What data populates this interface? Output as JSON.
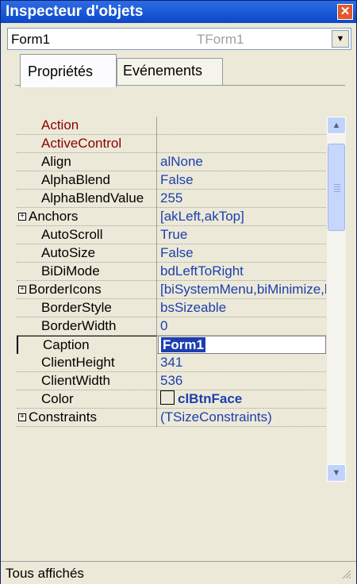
{
  "window": {
    "title": "Inspecteur d'objets"
  },
  "object_combo": {
    "name": "Form1",
    "class": "TForm1"
  },
  "tabs": [
    {
      "label": "Propriétés"
    },
    {
      "label": "Evénements"
    }
  ],
  "properties": [
    {
      "name": "Action",
      "value": ""
    },
    {
      "name": "ActiveControl",
      "value": ""
    },
    {
      "name": "Align",
      "value": "alNone"
    },
    {
      "name": "AlphaBlend",
      "value": "False"
    },
    {
      "name": "AlphaBlendValue",
      "value": "255"
    },
    {
      "name": "Anchors",
      "value": "[akLeft,akTop]"
    },
    {
      "name": "AutoScroll",
      "value": "True"
    },
    {
      "name": "AutoSize",
      "value": "False"
    },
    {
      "name": "BiDiMode",
      "value": "bdLeftToRight"
    },
    {
      "name": "BorderIcons",
      "value": "[biSystemMenu,biMinimize,biMaximize]"
    },
    {
      "name": "BorderStyle",
      "value": "bsSizeable"
    },
    {
      "name": "BorderWidth",
      "value": "0"
    },
    {
      "name": "Caption",
      "value": "Form1"
    },
    {
      "name": "ClientHeight",
      "value": "341"
    },
    {
      "name": "ClientWidth",
      "value": "536"
    },
    {
      "name": "Color",
      "value": "clBtnFace"
    },
    {
      "name": "Constraints",
      "value": "(TSizeConstraints)"
    }
  ],
  "status": {
    "text": "Tous affichés"
  },
  "colors": {
    "reference_name": "#8B0000",
    "value_text": "#1C3FAF",
    "title_bar": "#0B48C8",
    "window_bg": "#ECE9D8"
  },
  "icons": {
    "close": "close-icon",
    "dropdown": "chevron-down-icon",
    "expand": "plus-box-icon",
    "scroll_up": "chevron-up-icon",
    "scroll_down": "chevron-down-icon",
    "grip": "resize-grip-icon"
  }
}
